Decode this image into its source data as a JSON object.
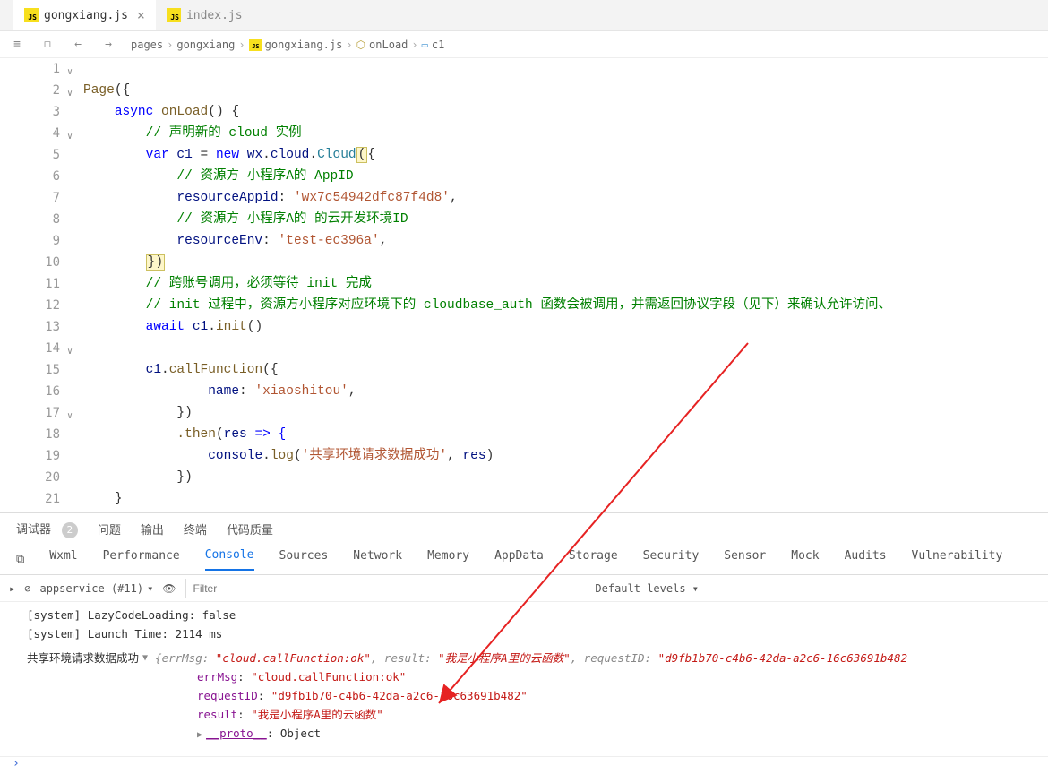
{
  "tabs": [
    {
      "label": "gongxiang.js",
      "active": true
    },
    {
      "label": "index.js",
      "active": false
    }
  ],
  "breadcrumb": {
    "seg1": "pages",
    "seg2": "gongxiang",
    "seg3": "gongxiang.js",
    "seg4": "onLoad",
    "seg5": "c1"
  },
  "code": {
    "l1_page": "Page",
    "l1_open": "({",
    "l2_async": "async",
    "l2_onload": " onLoad",
    "l2_paren": "() {",
    "l3_cm": "// 声明新的 cloud 实例",
    "l4_var": "var",
    "l4_c1": " c1 ",
    "l4_eq": "= ",
    "l4_new": "new",
    "l4_wx": " wx",
    "l4_dot1": ".",
    "l4_cloud": "cloud",
    "l4_dot2": ".",
    "l4_Cloud": "Cloud",
    "l4_paren": "(",
    "l4_brace": "{",
    "l5_cm": "// 资源方 小程序A的 AppID",
    "l6_key": "resourceAppid",
    "l6_colon": ": ",
    "l6_val": "'wx7c54942dfc87f4d8'",
    "l6_comma": ",",
    "l7_cm": "// 资源方 小程序A的 的云开发环境ID",
    "l8_key": "resourceEnv",
    "l8_colon": ": ",
    "l8_val": "'test-ec396a'",
    "l8_comma": ",",
    "l9_close": "})",
    "l10_cm": "// 跨账号调用，必须等待 init 完成",
    "l11_cm": "// init 过程中，资源方小程序对应环境下的 cloudbase_auth 函数会被调用，并需返回协议字段（见下）来确认允许访问、",
    "l12_await": "await",
    "l12_c1": " c1",
    "l12_dot": ".",
    "l12_init": "init",
    "l12_paren": "()",
    "l14_c1": "c1",
    "l14_dot": ".",
    "l14_fn": "callFunction",
    "l14_open": "({",
    "l15_key": "name",
    "l15_colon": ": ",
    "l15_val": "'xiaoshitou'",
    "l15_comma": ",",
    "l16_close": "})",
    "l17_then": ".then",
    "l17_open": "(",
    "l17_res": "res",
    "l17_arrow": " => {",
    "l18_console": "console",
    "l18_dot": ".",
    "l18_log": "log",
    "l18_open": "(",
    "l18_str": "'共享环境请求数据成功'",
    "l18_comma": ", ",
    "l18_res": "res",
    "l18_close": ")",
    "l19_close": "})",
    "l20_close": "}",
    "l21_close": "})"
  },
  "panelTabs": {
    "t1": "调试器",
    "badge": "2",
    "t2": "问题",
    "t3": "输出",
    "t4": "终端",
    "t5": "代码质量"
  },
  "devtoolsTabs": {
    "wxml": "Wxml",
    "perf": "Performance",
    "console": "Console",
    "sources": "Sources",
    "network": "Network",
    "memory": "Memory",
    "appdata": "AppData",
    "storage": "Storage",
    "security": "Security",
    "sensor": "Sensor",
    "mock": "Mock",
    "audits": "Audits",
    "vuln": "Vulnerability"
  },
  "consoleToolbar": {
    "context": "appservice (#11)",
    "filterPlaceholder": "Filter",
    "levels": "Default levels ▾"
  },
  "console": {
    "l1": "[system] LazyCodeLoading: false",
    "l2": "[system] Launch Time: 2114 ms",
    "l3_msg": "共享环境请求数据成功",
    "l3_obj_open": "{errMsg: ",
    "l3_errMsg_v": "\"cloud.callFunction:ok\"",
    "l3_mid1": ", result: ",
    "l3_result_v": "\"我是小程序A里的云函数\"",
    "l3_mid2": ", requestID: ",
    "l3_reqid_v": "\"d9fb1b70-c4b6-42da-a2c6-16c63691b482",
    "row_errMsg_k": "errMsg",
    "row_errMsg_v": "\"cloud.callFunction:ok\"",
    "row_reqid_k": "requestID",
    "row_reqid_v": "\"d9fb1b70-c4b6-42da-a2c6-16c63691b482\"",
    "row_result_k": "result",
    "row_result_v": "\"我是小程序A里的云函数\"",
    "row_proto_k": "__proto__",
    "row_proto_v": "Object"
  }
}
